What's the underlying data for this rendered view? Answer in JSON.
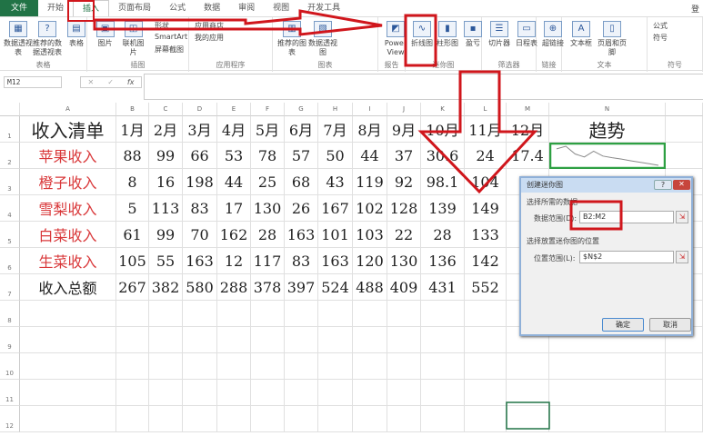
{
  "tabs": [
    "文件",
    "开始",
    "插入",
    "页面布局",
    "公式",
    "数据",
    "审阅",
    "视图",
    "开发工具"
  ],
  "active_tab": "插入",
  "user": "登",
  "ribbon": {
    "groups": [
      {
        "label": "表格",
        "buttons": [
          "数据透视表",
          "推荐的数据透视表",
          "表格"
        ]
      },
      {
        "label": "插图",
        "buttons": [
          "图片",
          "联机图片"
        ],
        "small": [
          "形状",
          "SmartArt",
          "屏幕截图"
        ]
      },
      {
        "label": "应用程序",
        "small": [
          "应用商店",
          "我的应用"
        ]
      },
      {
        "label": "图表",
        "buttons": [
          "推荐的图表",
          "数据透视图"
        ]
      },
      {
        "label": "报告",
        "buttons": [
          "Power View"
        ]
      },
      {
        "label": "迷你图",
        "buttons": [
          "折线图",
          "柱形图",
          "盈亏"
        ]
      },
      {
        "label": "筛选器",
        "buttons": [
          "切片器",
          "日程表"
        ]
      },
      {
        "label": "链接",
        "buttons": [
          "超链接"
        ]
      },
      {
        "label": "文本",
        "buttons": [
          "文本框",
          "页眉和页脚"
        ]
      },
      {
        "label": "符号",
        "small": [
          "公式",
          "符号"
        ]
      }
    ]
  },
  "formula_bar": {
    "name_box": "M12",
    "value": ""
  },
  "columns": [
    "A",
    "B",
    "C",
    "D",
    "E",
    "F",
    "G",
    "H",
    "I",
    "J",
    "K",
    "L",
    "M",
    "N"
  ],
  "rows": [
    [
      "收入清单",
      "1月",
      "2月",
      "3月",
      "4月",
      "5月",
      "6月",
      "7月",
      "8月",
      "9月",
      "10月",
      "11月",
      "12月",
      "趋势"
    ],
    [
      "苹果收入",
      "88",
      "99",
      "66",
      "53",
      "78",
      "57",
      "50",
      "44",
      "37",
      "30.6",
      "24",
      "17.4",
      ""
    ],
    [
      "橙子收入",
      "8",
      "16",
      "198",
      "44",
      "25",
      "68",
      "43",
      "119",
      "92",
      "98.1",
      "104",
      "",
      ""
    ],
    [
      "雪梨收入",
      "5",
      "113",
      "83",
      "17",
      "130",
      "26",
      "167",
      "102",
      "128",
      "139",
      "149",
      "",
      ""
    ],
    [
      "白菜收入",
      "61",
      "99",
      "70",
      "162",
      "28",
      "163",
      "101",
      "103",
      "22",
      "28",
      "133",
      "",
      ""
    ],
    [
      "生菜收入",
      "105",
      "55",
      "163",
      "12",
      "117",
      "83",
      "163",
      "120",
      "130",
      "136",
      "142",
      "",
      ""
    ],
    [
      "收入总额",
      "267",
      "382",
      "580",
      "288",
      "378",
      "397",
      "524",
      "488",
      "409",
      "431",
      "552",
      "",
      ""
    ]
  ],
  "row_numbers": [
    "1",
    "2",
    "3",
    "4",
    "5",
    "6",
    "7",
    "8",
    "9",
    "10",
    "11",
    "12"
  ],
  "sparkline": {
    "cell": "N2",
    "values": [
      88,
      99,
      66,
      53,
      78,
      57,
      50,
      44,
      37,
      30.6,
      24,
      17.4
    ],
    "color": "#8a8a8a",
    "highlight": "#2ea043"
  },
  "dialog": {
    "title": "创建迷你图",
    "section1": "选择所需的数据",
    "data_range_label": "数据范围(D):",
    "data_range": "B2:M2",
    "section2": "选择放置迷你图的位置",
    "location_label": "位置范围(L):",
    "location": "$N$2",
    "ok": "确定",
    "cancel": "取消",
    "help": "?",
    "close": "✕"
  },
  "annotation_color": "#d0161c"
}
